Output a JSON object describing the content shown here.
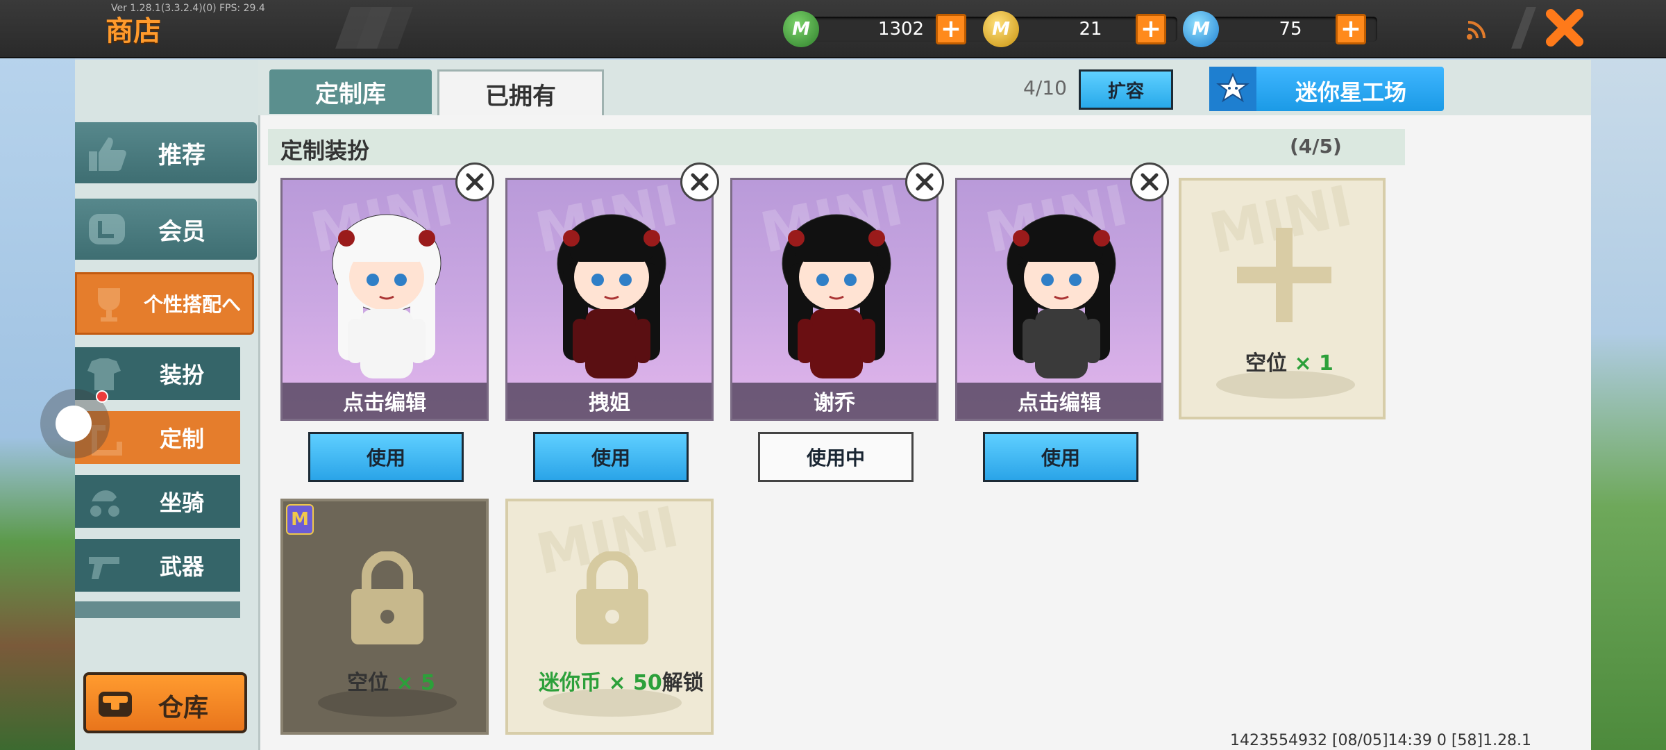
{
  "topbar": {
    "version": "Ver 1.28.1(3.3.2.4)(0) FPS: 29.4",
    "title": "商店",
    "currencies": [
      {
        "icon": "mini-bean-icon",
        "value": "1302",
        "color": "#3b9a3b"
      },
      {
        "icon": "mini-coin-icon",
        "value": "21",
        "color": "#e0b627"
      },
      {
        "icon": "mini-point-icon",
        "value": "75",
        "color": "#3aa6e8"
      }
    ]
  },
  "sidebar": {
    "items": [
      {
        "label": "推荐",
        "icon": "thumbs-up-icon"
      },
      {
        "label": "会员",
        "icon": "vip-icon"
      },
      {
        "label": "个性搭配",
        "icon": "trophy-icon"
      },
      {
        "label": "装扮",
        "icon": "shirt-icon"
      },
      {
        "label": "定制",
        "icon": "customize-icon"
      },
      {
        "label": "坐骑",
        "icon": "mount-icon"
      },
      {
        "label": "武器",
        "icon": "gun-icon"
      }
    ],
    "expand_arrow": "へ",
    "warehouse_label": "仓库"
  },
  "tabs": [
    "定制库",
    "已拥有"
  ],
  "capacity": "4/10",
  "expand_label": "扩容",
  "workshop_label": "迷你星工场",
  "section": {
    "title": "定制装扮",
    "count": "(4/5)"
  },
  "outfits": [
    {
      "name": "点击编辑",
      "button": "使用",
      "in_use": false,
      "hair": "#f8f8f8",
      "clothes": "#f5f5f5"
    },
    {
      "name": "拽姐",
      "button": "使用",
      "in_use": false,
      "hair": "#111111",
      "clothes": "#5a0f12"
    },
    {
      "name": "谢乔",
      "button": "使用中",
      "in_use": true,
      "hair": "#111111",
      "clothes": "#6a0f12"
    },
    {
      "name": "点击编辑",
      "button": "使用",
      "in_use": false,
      "hair": "#111111",
      "clothes": "#3a3a3a"
    }
  ],
  "empty_slot": {
    "label": "空位",
    "count": "× 1"
  },
  "locked_slots": [
    {
      "label": "空位",
      "count": "× 5"
    },
    {
      "price": "迷你币 × 50",
      "suffix": "解锁"
    }
  ],
  "footer": "1423554932  [08/05]14:39 0  [58]1.28.1"
}
